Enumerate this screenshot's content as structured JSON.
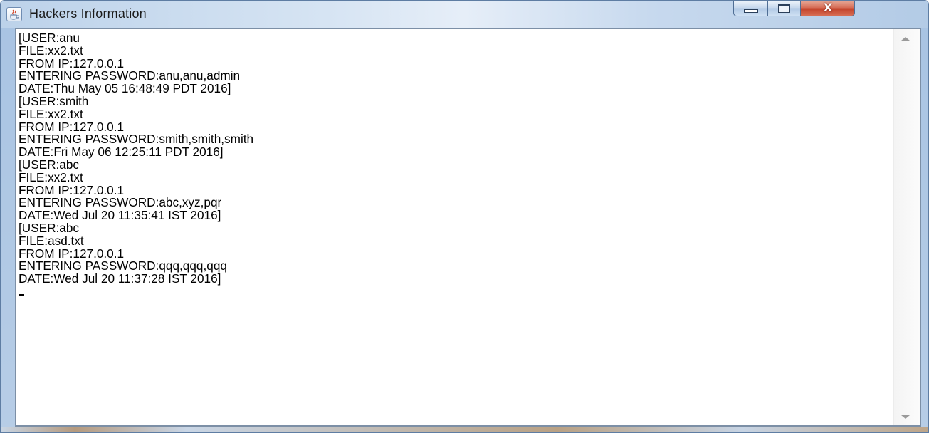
{
  "window": {
    "title": "Hackers Information",
    "close_symbol": "X"
  },
  "icons": {
    "app": "java-cup-icon",
    "minimize": "minimize-icon",
    "maximize": "maximize-icon",
    "close": "close-icon",
    "scroll_up": "chevron-up-icon",
    "scroll_down": "chevron-down-icon"
  },
  "colors": {
    "title_bar": "#bcd2ea",
    "close_button": "#c3432b",
    "text": "#000000",
    "background": "#ffffff"
  },
  "log": {
    "lines": [
      "[USER:anu",
      "FILE:xx2.txt",
      "FROM IP:127.0.0.1",
      "ENTERING PASSWORD:anu,anu,admin",
      "DATE:Thu May 05 16:48:49 PDT 2016]",
      "[USER:smith",
      "FILE:xx2.txt",
      "FROM IP:127.0.0.1",
      "ENTERING PASSWORD:smith,smith,smith",
      "DATE:Fri May 06 12:25:11 PDT 2016]",
      "[USER:abc",
      "FILE:xx2.txt",
      "FROM IP:127.0.0.1",
      "ENTERING PASSWORD:abc,xyz,pqr",
      "DATE:Wed Jul 20 11:35:41 IST 2016]",
      "[USER:abc",
      "FILE:asd.txt",
      "FROM IP:127.0.0.1",
      "ENTERING PASSWORD:qqq,qqq,qqq",
      "DATE:Wed Jul 20 11:37:28 IST 2016]"
    ]
  }
}
